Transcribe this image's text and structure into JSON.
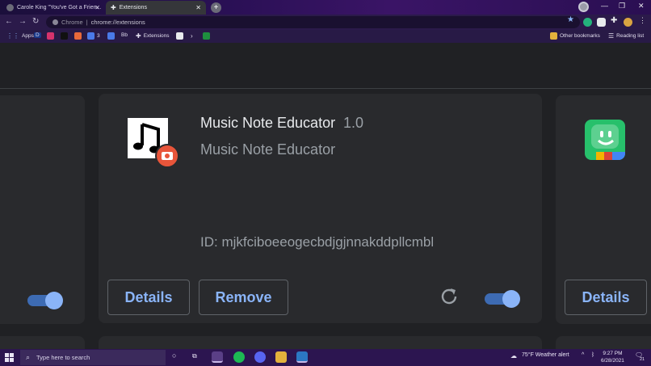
{
  "browser": {
    "tabs": [
      {
        "label": "Carole King \"You've Got a Frien...",
        "active": false
      },
      {
        "label": "Extensions",
        "active": true
      }
    ],
    "omnibox": {
      "site_label": "Chrome",
      "separator": "|",
      "url": "chrome://extensions"
    },
    "bookmarks": [
      {
        "label": "Apps"
      },
      {
        "label": "D"
      },
      {
        "label": "3"
      },
      {
        "label": "Bb"
      },
      {
        "label": "Extensions"
      }
    ],
    "other_bookmarks": "Other bookmarks",
    "reading_list": "Reading list"
  },
  "extension": {
    "name": "Music Note Educator",
    "version": "1.0",
    "description": "Music Note Educator",
    "id_text": "ID: mjkfciboeeogecbdjgjnnakddpllcmbl",
    "details_label": "Details",
    "remove_label": "Remove",
    "enabled": true
  },
  "right_card": {
    "details_label": "Details",
    "enabled": true
  },
  "left_card": {
    "enabled": true
  },
  "taskbar": {
    "search_placeholder": "Type here to search",
    "weather": "75°F  Weather alert",
    "time": "9:27 PM",
    "date": "6/28/2021",
    "notifications": "21"
  },
  "colors": {
    "accent": "#8ab4f8",
    "card": "#292a2d",
    "page": "#202124",
    "badge": "#e8553a"
  }
}
